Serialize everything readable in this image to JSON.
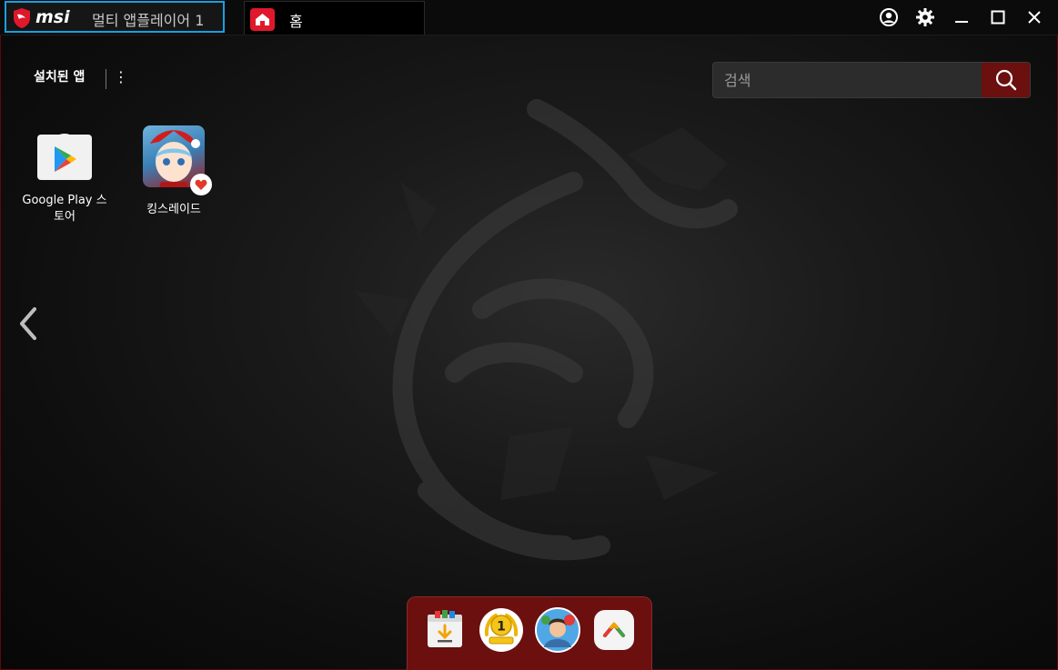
{
  "titlebar": {
    "brand": "msi",
    "instance_name": "멀티 앱플레이어 1",
    "tab_label": "홈"
  },
  "window_controls": {
    "account_icon": "account-circle-icon",
    "settings_icon": "gear-icon",
    "minimize_icon": "minimize-icon",
    "maximize_icon": "maximize-icon",
    "close_icon": "close-icon"
  },
  "main": {
    "section_title": "설치된 앱",
    "menu_glyph": "⋮"
  },
  "search": {
    "placeholder": "검색",
    "value": ""
  },
  "apps": [
    {
      "label": "Google Play 스토어",
      "icon": "google-play-store-icon"
    },
    {
      "label": "킹스레이드",
      "icon": "kings-raid-icon"
    }
  ],
  "dock": {
    "items": [
      "install-apk-icon",
      "level-one-badge-icon",
      "avatar-game-icon",
      "app-center-icon"
    ],
    "level_text": "1"
  },
  "colors": {
    "brand_red": "#e0182b",
    "accent_blue": "#1a9fe0",
    "dock_red": "#6b0f0f"
  }
}
